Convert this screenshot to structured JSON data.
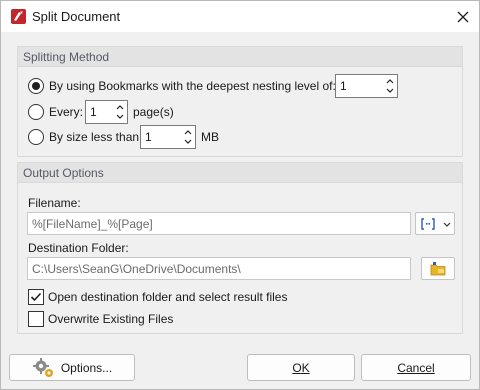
{
  "window": {
    "title": "Split Document"
  },
  "splitting_method": {
    "heading": "Splitting Method",
    "bookmarks": {
      "label": "By using Bookmarks with the deepest nesting level of:",
      "value": "1",
      "selected": true
    },
    "every": {
      "label": "Every:",
      "value": "1",
      "suffix": "page(s)",
      "selected": false
    },
    "size": {
      "label": "By size less than:",
      "value": "1",
      "suffix": "MB",
      "selected": false
    }
  },
  "output_options": {
    "heading": "Output Options",
    "filename_label": "Filename:",
    "filename_value": "%[FileName]_%[Page]",
    "destination_label": "Destination Folder:",
    "destination_value": "C:\\Users\\SeanG\\OneDrive\\Documents\\",
    "open_folder": {
      "label": "Open destination folder and select result files",
      "checked": true
    },
    "overwrite": {
      "label": "Overwrite Existing Files",
      "checked": false
    }
  },
  "footer": {
    "options_label": "Options...",
    "ok_label": "OK",
    "cancel_label": "Cancel"
  },
  "icons": {
    "app": "pdf-app-icon",
    "close": "close-icon",
    "macro": "macro-icon",
    "dropdown": "chevron-down-icon",
    "folder": "folder-icon",
    "options": "gears-icon"
  },
  "colors": {
    "accent": "#2b5fbe",
    "app_red": "#c0272d",
    "folder_yellow": "#e8b524"
  }
}
